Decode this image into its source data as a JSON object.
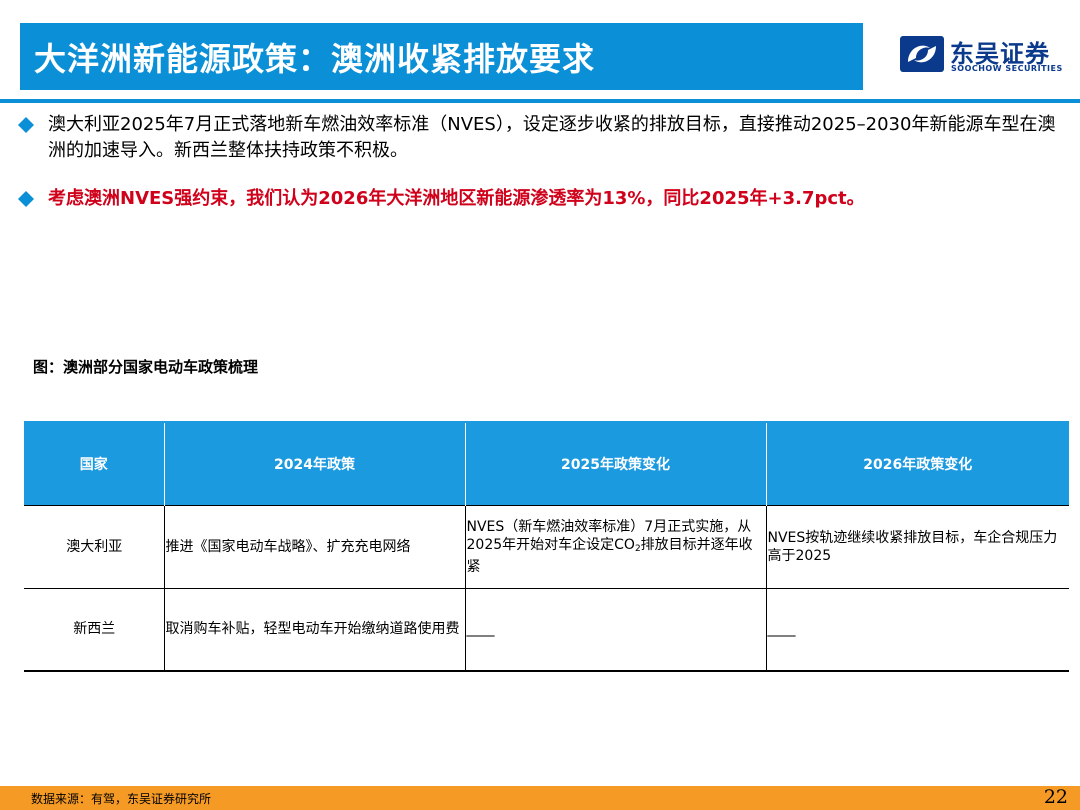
{
  "header": {
    "title": "大洋洲新能源政策：澳洲收紧排放要求",
    "logo_cn": "东吴证券",
    "logo_en": "SOOCHOW SECURITIES"
  },
  "bullets": [
    "澳大利亚2025年7月正式落地新车燃油效率标准（NVES），设定逐步收紧的排放目标，直接推动2025–2030年新能源车型在澳洲的加速导入。新西兰整体扶持政策不积极。",
    "考虑澳洲NVES强约束，我们认为2026年大洋洲地区新能源渗透率为13%，同比2025年+3.7pct。"
  ],
  "figure": {
    "caption": "图：澳洲部分国家电动车政策梳理",
    "columns": [
      "国家",
      "2024年政策",
      "2025年政策变化",
      "2026年政策变化"
    ],
    "rows": [
      {
        "country": "澳大利亚",
        "policy_2024": "推进《国家电动车战略》、扩充充电网络",
        "policy_2025_a": "NVES（新车燃油效率标准）7月正式实施，从2025年开始对车企设定CO",
        "policy_2025_sub": "2",
        "policy_2025_b": "排放目标并逐年收紧",
        "policy_2026": "NVES按轨迹继续收紧排放目标，车企合规压力高于2025"
      },
      {
        "country": "新西兰",
        "policy_2024": "取消购车补贴，轻型电动车开始缴纳道路使用费",
        "policy_2025": "____",
        "policy_2026": "____"
      }
    ]
  },
  "footer": {
    "source": "数据来源：有驾，东吴证券研究所",
    "page_number": "22"
  },
  "colors": {
    "title_blue": "#0b8fd6",
    "table_header_blue": "#1b9ae0",
    "highlight_red": "#d0011b",
    "footer_orange": "#f59b25",
    "logo_navy": "#0b3a8c"
  }
}
